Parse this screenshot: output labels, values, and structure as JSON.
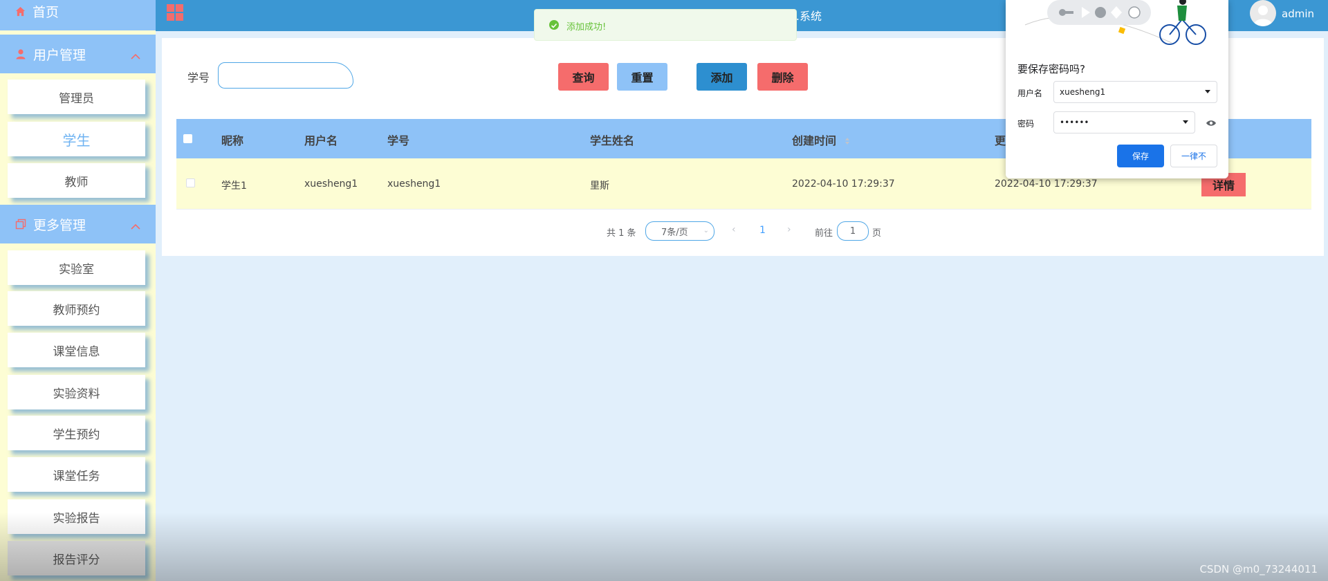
{
  "sidebar": {
    "home": {
      "label": "首页",
      "icon": "home-icon"
    },
    "user_mgmt": {
      "label": "用户管理",
      "icon": "user-icon"
    },
    "user_items": [
      {
        "label": "管理员"
      },
      {
        "label": "学生",
        "active": true
      },
      {
        "label": "教师"
      }
    ],
    "more_mgmt": {
      "label": "更多管理",
      "icon": "copy-icon"
    },
    "more_items": [
      {
        "label": "实验室"
      },
      {
        "label": "教师预约"
      },
      {
        "label": "课堂信息"
      },
      {
        "label": "实验资料"
      },
      {
        "label": "学生预约"
      },
      {
        "label": "课堂任务"
      },
      {
        "label": "实验报告"
      },
      {
        "label": "报告评分"
      }
    ]
  },
  "header": {
    "title": "…系统",
    "username": "admin"
  },
  "search": {
    "label": "学号",
    "value": "",
    "buttons": {
      "query": "查询",
      "reset": "重置",
      "add": "添加",
      "delete": "删除"
    }
  },
  "table": {
    "columns": [
      "昵称",
      "用户名",
      "学号",
      "学生姓名",
      "创建时间",
      "更"
    ],
    "rows": [
      {
        "nickname": "学生1",
        "username": "xuesheng1",
        "student_no": "xuesheng1",
        "student_name": "里斯",
        "created": "2022-04-10 17:29:37",
        "updated": "2022-04-10 17:29:37",
        "action": "详情"
      }
    ]
  },
  "pagination": {
    "total": "共 1 条",
    "page_size": "7条/页",
    "current": "1",
    "goto_label": "前往",
    "goto_value": "1",
    "page_suffix": "页"
  },
  "toast": {
    "text": "添加成功!",
    "type": "success"
  },
  "password_popup": {
    "title": "要保存密码吗?",
    "username_label": "用户名",
    "username_value": "xuesheng1",
    "password_label": "密码",
    "password_value": "••••••",
    "save": "保存",
    "never": "一律不"
  },
  "watermark": "CSDN @m0_73244011",
  "colors": {
    "sidebar_head": "#8ec2f7",
    "topbar": "#3b97d3",
    "danger": "#f56c6c",
    "primary": "#2d8fd0",
    "row_bg": "#fdfdd4",
    "success": "#67c23a"
  }
}
